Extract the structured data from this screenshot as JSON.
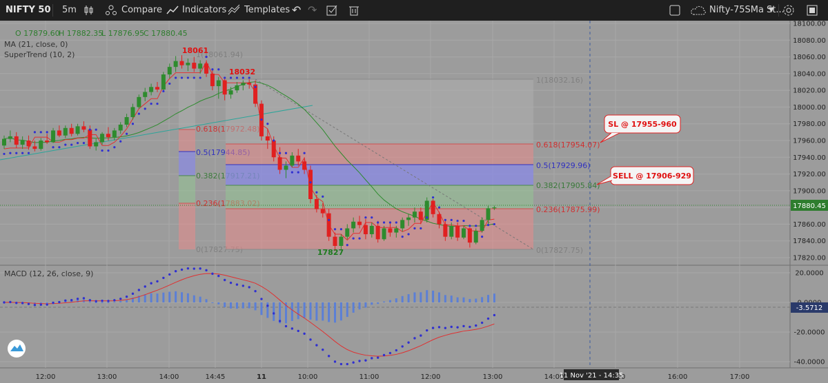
{
  "toolbar": {
    "symbol": "NIFTY 50",
    "interval": "5m",
    "compare": "Compare",
    "indicators": "Indicators",
    "templates": "Templates",
    "layout_name": "Nifty-75SMa St..."
  },
  "legend": {
    "ohlc_open": "O 17879.60",
    "ohlc_high": "H 17882.35",
    "ohlc_low": "L 17876.95",
    "ohlc_close": "C 17880.45",
    "ma": "MA (21, close, 0)",
    "supertrend": "SuperTrend (10, 2)",
    "macd": "MACD (12, 26, close, 9)"
  },
  "annotations": {
    "high1": "18061",
    "high2": "18032",
    "low": "17827",
    "sl_note": "SL @ 17955-960",
    "sell_note": "SELL @ 17906-929"
  },
  "fib_left": {
    "top": "1(18061.94)",
    "l618": "0.618(17972.48)",
    "l5": "0.5(17944.85)",
    "l382": "0.382(17917.21)",
    "l236": "0.236(17883.02)",
    "bottom": "0(17827.75)"
  },
  "fib_right": {
    "top": "1(18032.16)",
    "l618": "0.618(17954.07)",
    "l5": "0.5(17929.96)",
    "l382": "0.382(17905.84)",
    "l236": "0.236(17875.99)",
    "bottom": "0(17827.75)"
  },
  "price_axis": {
    "ticks": [
      "18100.00",
      "18080.00",
      "18060.00",
      "18040.00",
      "18020.00",
      "18000.00",
      "17980.00",
      "17960.00",
      "17940.00",
      "17920.00",
      "17900.00",
      "17880.00",
      "17860.00",
      "17840.00",
      "17820.00"
    ],
    "last_price": "17880.45"
  },
  "macd_axis": {
    "ticks": [
      "20.0000",
      "0.0000",
      "-20.0000",
      "-40.0000"
    ],
    "last_value": "-3.5712"
  },
  "time_axis": {
    "labels": [
      "12:00",
      "13:00",
      "14:00",
      "14:45",
      "11",
      "10:00",
      "11:00",
      "12:00",
      "13:00",
      "14:00",
      "15:00",
      "16:00",
      "17:00"
    ],
    "crosshair": "11 Nov '21 - 14:35"
  },
  "colors": {
    "bull": "#2e8b2e",
    "bear": "#e02020",
    "supertrend_dots": "#3030d0",
    "fib_red": "#e88a8a",
    "fib_blue": "#8a8ae6",
    "fib_green": "#93c493",
    "macd_hist": "#5b7fd6"
  },
  "chart_data": {
    "type": "candlestick",
    "instrument": "NIFTY 50",
    "timeframe": "5m",
    "ylim": [
      17820,
      18100
    ],
    "macd_ylim": [
      -40,
      20
    ],
    "candles": [
      [
        17954,
        17966,
        17950,
        17962
      ],
      [
        17962,
        17972,
        17958,
        17965
      ],
      [
        17965,
        17970,
        17951,
        17955
      ],
      [
        17955,
        17965,
        17950,
        17960
      ],
      [
        17960,
        17966,
        17949,
        17953
      ],
      [
        17953,
        17960,
        17947,
        17950
      ],
      [
        17950,
        17963,
        17948,
        17960
      ],
      [
        17960,
        17968,
        17956,
        17958
      ],
      [
        17958,
        17975,
        17957,
        17972
      ],
      [
        17972,
        17978,
        17964,
        17966
      ],
      [
        17966,
        17978,
        17963,
        17975
      ],
      [
        17975,
        17980,
        17965,
        17968
      ],
      [
        17968,
        17980,
        17966,
        17977
      ],
      [
        17977,
        17983,
        17970,
        17973
      ],
      [
        17973,
        17978,
        17950,
        17953
      ],
      [
        17953,
        17962,
        17948,
        17958
      ],
      [
        17958,
        17970,
        17955,
        17968
      ],
      [
        17968,
        17976,
        17960,
        17964
      ],
      [
        17964,
        17975,
        17960,
        17972
      ],
      [
        17972,
        17982,
        17968,
        17979
      ],
      [
        17979,
        17992,
        17976,
        17988
      ],
      [
        17988,
        18004,
        17985,
        18000
      ],
      [
        18000,
        18015,
        17998,
        18012
      ],
      [
        18012,
        18023,
        18007,
        18018
      ],
      [
        18018,
        18028,
        18014,
        18024
      ],
      [
        18024,
        18030,
        18018,
        18021
      ],
      [
        18021,
        18042,
        18020,
        18039
      ],
      [
        18039,
        18052,
        18034,
        18048
      ],
      [
        18048,
        18061,
        18042,
        18055
      ],
      [
        18055,
        18062,
        18046,
        18050
      ],
      [
        18050,
        18058,
        18043,
        18053
      ],
      [
        18053,
        18060,
        18042,
        18046
      ],
      [
        18046,
        18056,
        18040,
        18052
      ],
      [
        18052,
        18056,
        18036,
        18040
      ],
      [
        18040,
        18044,
        18020,
        18025
      ],
      [
        18025,
        18036,
        18010,
        18032
      ],
      [
        18032,
        18034,
        18008,
        18015
      ],
      [
        18015,
        18024,
        18010,
        18020
      ],
      [
        18020,
        18030,
        18017,
        18026
      ],
      [
        18026,
        18032,
        18020,
        18029
      ],
      [
        18029,
        18033,
        18022,
        18027
      ],
      [
        18027,
        18032,
        18000,
        18004
      ],
      [
        18004,
        18008,
        17960,
        17965
      ],
      [
        17965,
        17974,
        17950,
        17960
      ],
      [
        17960,
        17965,
        17935,
        17940
      ],
      [
        17940,
        17952,
        17920,
        17925
      ],
      [
        17925,
        17935,
        17915,
        17930
      ],
      [
        17930,
        17946,
        17928,
        17942
      ],
      [
        17942,
        17950,
        17930,
        17935
      ],
      [
        17935,
        17940,
        17920,
        17925
      ],
      [
        17925,
        17930,
        17885,
        17890
      ],
      [
        17890,
        17895,
        17874,
        17878
      ],
      [
        17878,
        17885,
        17868,
        17873
      ],
      [
        17873,
        17878,
        17840,
        17845
      ],
      [
        17845,
        17850,
        17828,
        17834
      ],
      [
        17834,
        17848,
        17830,
        17845
      ],
      [
        17845,
        17860,
        17842,
        17855
      ],
      [
        17855,
        17868,
        17850,
        17863
      ],
      [
        17863,
        17870,
        17855,
        17859
      ],
      [
        17859,
        17866,
        17842,
        17848
      ],
      [
        17848,
        17862,
        17844,
        17858
      ],
      [
        17858,
        17864,
        17838,
        17842
      ],
      [
        17842,
        17858,
        17840,
        17855
      ],
      [
        17855,
        17862,
        17845,
        17850
      ],
      [
        17850,
        17858,
        17844,
        17855
      ],
      [
        17855,
        17868,
        17851,
        17865
      ],
      [
        17865,
        17872,
        17858,
        17868
      ],
      [
        17868,
        17880,
        17862,
        17875
      ],
      [
        17875,
        17880,
        17860,
        17865
      ],
      [
        17865,
        17892,
        17862,
        17888
      ],
      [
        17888,
        17890,
        17868,
        17872
      ],
      [
        17872,
        17875,
        17855,
        17860
      ],
      [
        17860,
        17864,
        17840,
        17845
      ],
      [
        17845,
        17862,
        17842,
        17858
      ],
      [
        17858,
        17862,
        17840,
        17844
      ],
      [
        17844,
        17858,
        17842,
        17855
      ],
      [
        17855,
        17856,
        17832,
        17838
      ],
      [
        17838,
        17855,
        17836,
        17852
      ],
      [
        17852,
        17868,
        17850,
        17865
      ],
      [
        17865,
        17882,
        17860,
        17879
      ],
      [
        17879,
        17882,
        17877,
        17880
      ]
    ]
  }
}
